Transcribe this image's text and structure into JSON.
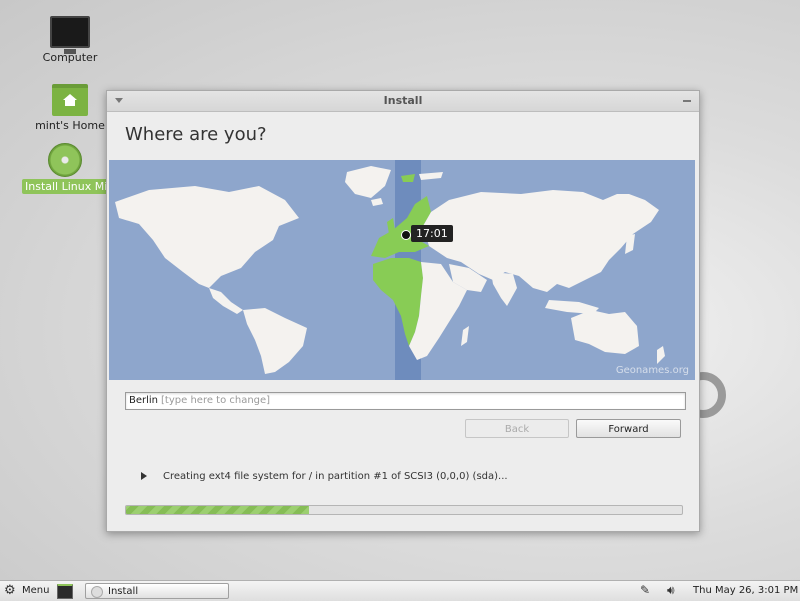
{
  "desktop": {
    "icons": [
      {
        "label": "Computer",
        "icon": "computer-icon"
      },
      {
        "label": "mint's Home",
        "icon": "home-folder-icon"
      },
      {
        "label": "Install Linux Mint",
        "icon": "install-disc-icon"
      }
    ]
  },
  "window": {
    "title": "Install",
    "heading": "Where are you?",
    "map": {
      "selected_time": "17:01",
      "attribution": "Geonames.org"
    },
    "timezone_input": {
      "value": "Berlin",
      "placeholder": "[type here to change]"
    },
    "buttons": {
      "back": "Back",
      "forward": "Forward"
    },
    "progress": {
      "text": "Creating ext4 file system for / in partition #1 of SCSI3 (0,0,0) (sda)...",
      "fraction": 0.33
    }
  },
  "taskbar": {
    "menu_label": "Menu",
    "task_label": "Install",
    "clock": "Thu May 26,  3:01 PM"
  },
  "colors": {
    "ocean": "#8ea6cc",
    "land": "#f4f2ef",
    "selected_region": "#88cc55",
    "timezone_band": "#6e8cbd",
    "accent": "#8fc45a"
  }
}
